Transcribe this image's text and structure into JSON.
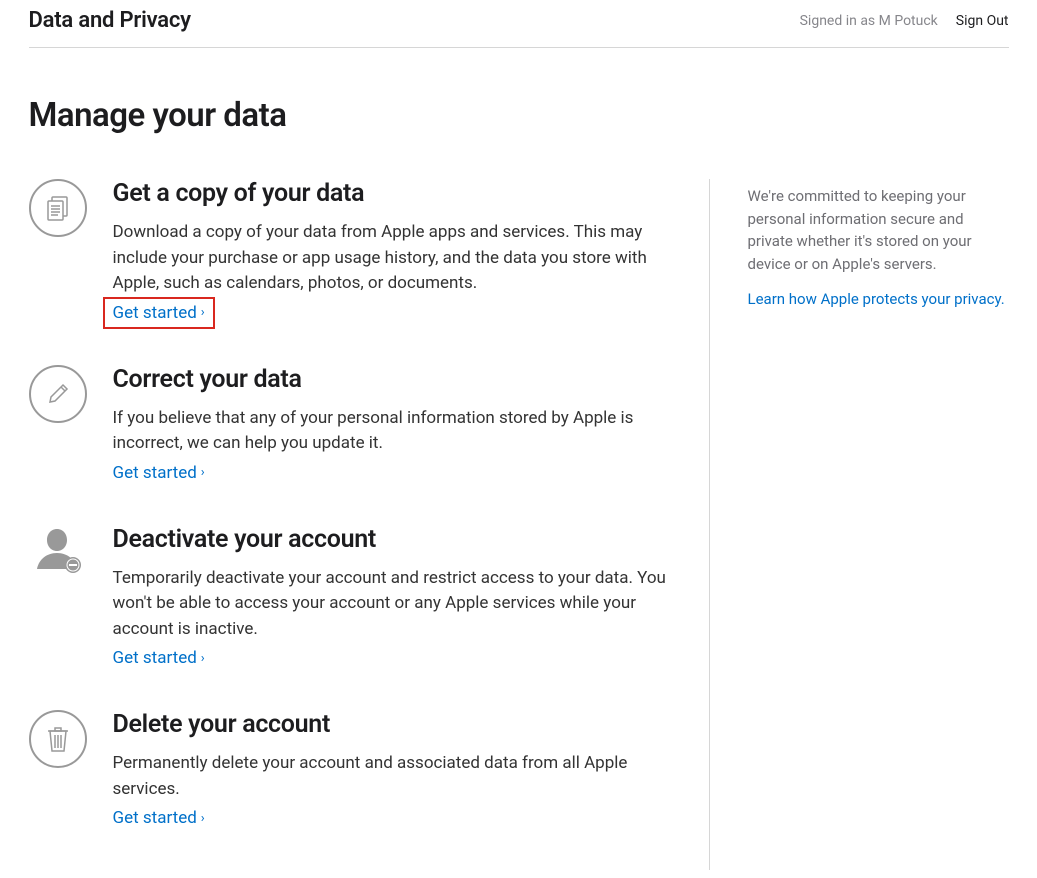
{
  "header": {
    "title": "Data and Privacy",
    "signed_in": "Signed in as M Potuck",
    "sign_out": "Sign Out"
  },
  "page_title": "Manage your data",
  "sections": [
    {
      "title": "Get a copy of your data",
      "desc": "Download a copy of your data from Apple apps and services. This may include your purchase or app usage history, and the data you store with Apple, such as calendars, photos, or documents.",
      "link": "Get started"
    },
    {
      "title": "Correct your data",
      "desc": "If you believe that any of your personal information stored by Apple is incorrect, we can help you update it.",
      "link": "Get started"
    },
    {
      "title": "Deactivate your account",
      "desc": "Temporarily deactivate your account and restrict access to your data. You won't be able to access your account or any Apple services while your account is inactive.",
      "link": "Get started"
    },
    {
      "title": "Delete your account",
      "desc": "Permanently delete your account and associated data from all Apple services.",
      "link": "Get started"
    }
  ],
  "sidebar": {
    "text": "We're committed to keeping your personal information secure and private whether it's stored on your device or on Apple's servers.",
    "link": "Learn how Apple protects your privacy."
  }
}
